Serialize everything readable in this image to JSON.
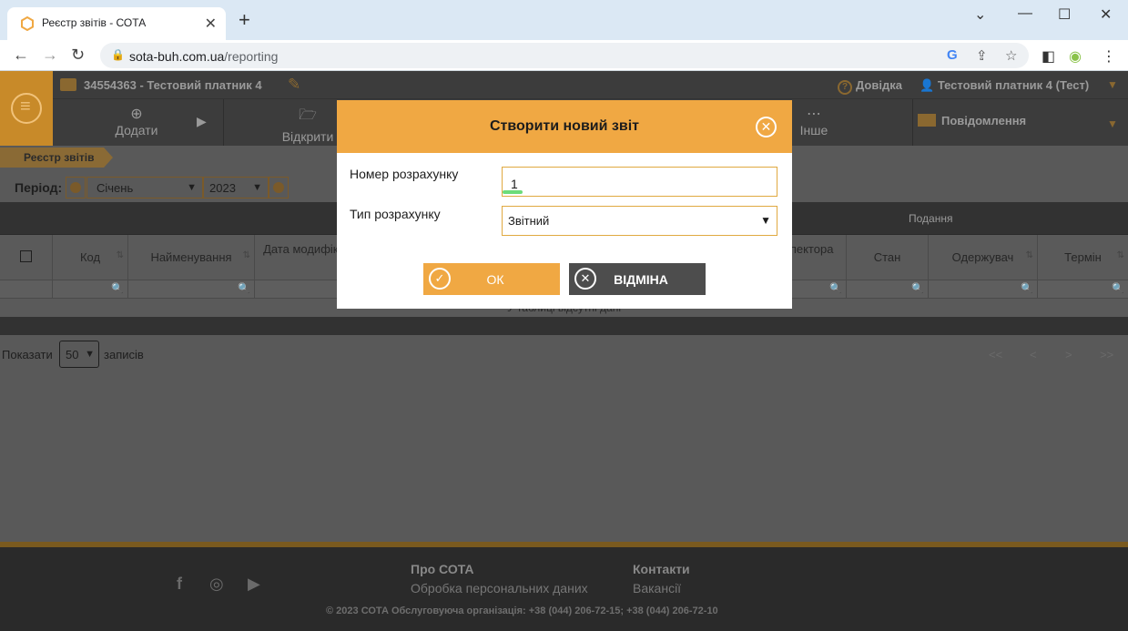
{
  "browser": {
    "tab_title": "Реєстр звітів - СОТА",
    "url_host": "sota-buh.com.ua",
    "url_path": "/reporting"
  },
  "header": {
    "company": "34554363 - Тестовий платник 4",
    "help": "Довідка",
    "user": "Тестовий платник 4 (Тест)"
  },
  "actions": {
    "add": "Додати",
    "open": "Відкрити",
    "other": "Інше",
    "messages": "Повідомлення"
  },
  "breadcrumb": "Реєстр звітів",
  "period": {
    "label": "Період:",
    "month": "Січень",
    "year": "2023"
  },
  "table": {
    "group_header": "Подання",
    "columns": [
      "Код",
      "Найменування",
      "Дата модифікації",
      "Код інспектора",
      "Стан",
      "Одержувач",
      "Термін"
    ],
    "empty_text": "У таблиці відсутні дані"
  },
  "pager": {
    "show": "Показати",
    "page_size": "50",
    "records": "записів",
    "first": "<<",
    "prev": "<",
    "next": ">",
    "last": ">>"
  },
  "footer": {
    "about": "Про СОТА",
    "privacy": "Обробка персональних даних",
    "contacts": "Контакти",
    "vacancies": "Вакансії",
    "copyright": "© 2023 СОТА Обслуговуюча організація: +38 (044) 206-72-15; +38 (044) 206-72-10"
  },
  "modal": {
    "title": "Створити новий звіт",
    "number_label": "Номер розрахунку",
    "number_value": "1",
    "type_label": "Тип розрахунку",
    "type_value": "Звітний",
    "ok": "ОК",
    "cancel": "ВІДМІНА"
  },
  "colors": {
    "accent": "#f0a843",
    "overlay_dark": "#595959",
    "footer_dark": "#2a2a2a"
  }
}
